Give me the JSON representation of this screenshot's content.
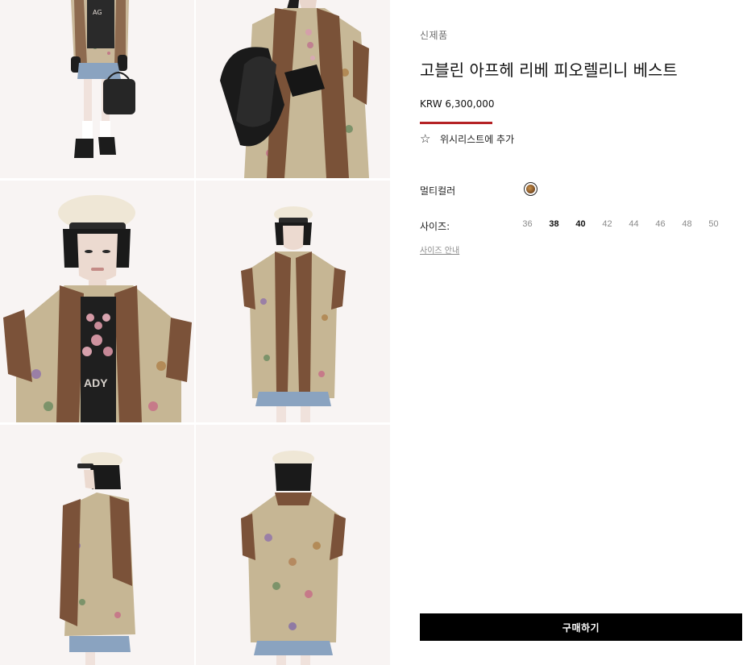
{
  "product": {
    "badge": "신제품",
    "title": "고블린 아프헤 리베 피오렐리니 베스트",
    "price": "KRW 6,300,000",
    "accent_color": "#b52225",
    "wishlist_icon": "star-outline-icon",
    "wishlist_label": "위시리스트에 추가"
  },
  "options": {
    "color_label": "멀티컬러",
    "selected_color": "multicolor",
    "size_label": "사이즈:",
    "sizes": [
      {
        "label": "36",
        "available": false
      },
      {
        "label": "38",
        "available": true
      },
      {
        "label": "40",
        "available": true
      },
      {
        "label": "42",
        "available": false
      },
      {
        "label": "44",
        "available": false
      },
      {
        "label": "46",
        "available": false
      },
      {
        "label": "48",
        "available": false
      },
      {
        "label": "50",
        "available": false
      }
    ],
    "size_guide": "사이즈 안내"
  },
  "actions": {
    "buy_label": "구매하기"
  },
  "gallery": {
    "images": [
      {
        "name": "look-full-front-with-bag",
        "text": "AG"
      },
      {
        "name": "look-closeup-handbag"
      },
      {
        "name": "look-portrait-beret",
        "text": "ADY"
      },
      {
        "name": "look-front-waist-up"
      },
      {
        "name": "look-side-profile"
      },
      {
        "name": "look-back-view"
      }
    ]
  }
}
